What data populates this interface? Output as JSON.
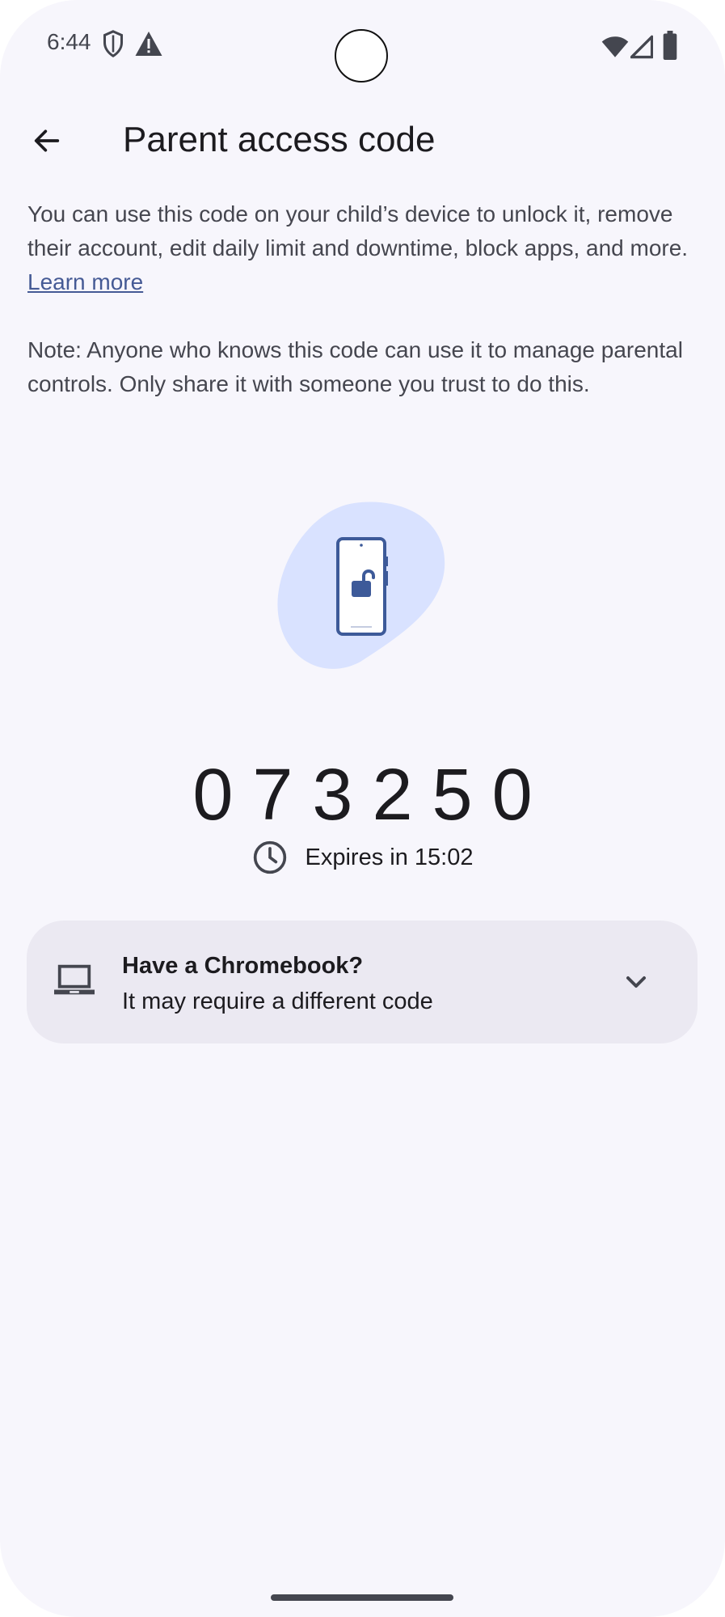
{
  "status_bar": {
    "time": "6:44",
    "icons": [
      "shield-icon",
      "alert-icon",
      "wifi-icon",
      "signal-icon",
      "battery-icon"
    ]
  },
  "app_bar": {
    "back_icon": "arrow-back-icon",
    "title": "Parent access code"
  },
  "description": {
    "text": "You can use this code on your child’s device to unlock it, remove their account, edit daily limit and downtime, block apps, and more. ",
    "learn_more": "Learn more",
    "note": "Note: Anyone who knows this code can use it to manage parental controls. Only share it with someone you trust to do this."
  },
  "illustration": {
    "icon": "phone-unlock-illustration"
  },
  "code": {
    "value": "073250",
    "expires_label": "Expires in 15:02",
    "clock_icon": "clock-icon"
  },
  "chromebook_card": {
    "title": "Have a Chromebook?",
    "subtitle": "It may require a different code",
    "icon": "laptop-icon",
    "chevron": "chevron-down-icon"
  },
  "colors": {
    "background": "#f7f6fc",
    "card": "#ebe9f2",
    "link": "#455a95",
    "blob": "#d9e2ff",
    "illustration_accent": "#3d5a99"
  }
}
